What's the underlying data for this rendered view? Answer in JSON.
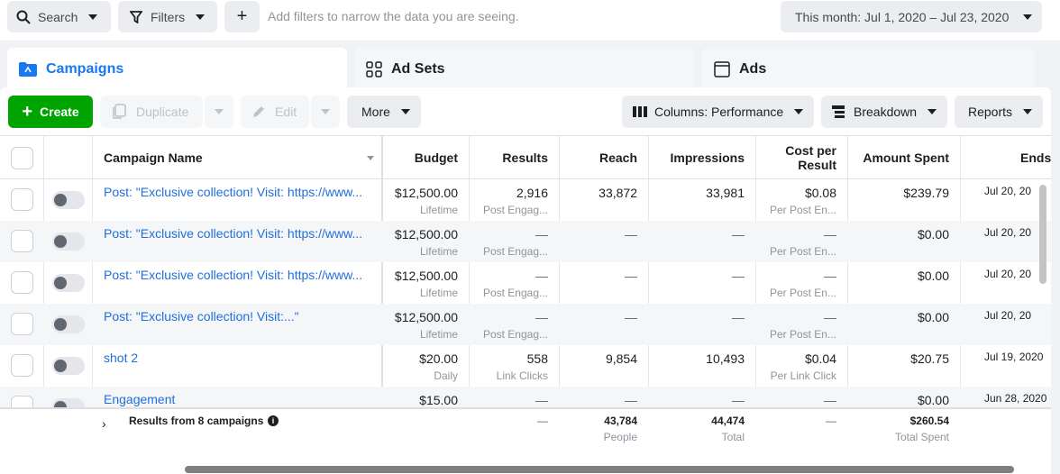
{
  "topbar": {
    "search_label": "Search",
    "filters_label": "Filters",
    "add_filters_text": "Add filters to narrow the data you are seeing.",
    "date_range": "This month: Jul 1, 2020 – Jul 23, 2020"
  },
  "tabs": [
    {
      "label": "Campaigns",
      "icon": "folder-icon"
    },
    {
      "label": "Ad Sets",
      "icon": "grid-icon"
    },
    {
      "label": "Ads",
      "icon": "window-icon"
    }
  ],
  "toolbar": {
    "create": "Create",
    "duplicate": "Duplicate",
    "edit": "Edit",
    "more": "More",
    "columns": "Columns: Performance",
    "breakdown": "Breakdown",
    "reports": "Reports"
  },
  "headers": {
    "name": "Campaign Name",
    "budget": "Budget",
    "results": "Results",
    "reach": "Reach",
    "impressions": "Impressions",
    "cost_line1": "Cost per",
    "cost_line2": "Result",
    "spent": "Amount Spent",
    "ends": "Ends"
  },
  "rows": [
    {
      "name": "Post: \"Exclusive collection! Visit: https://www...",
      "budget": "$12,500.00",
      "budget_type": "Lifetime",
      "results": "2,916",
      "results_type": "Post Engag...",
      "reach": "33,872",
      "impressions": "33,981",
      "cost": "$0.08",
      "cost_type": "Per Post En...",
      "spent": "$239.79",
      "ends": "Jul 20, 20"
    },
    {
      "name": "Post: \"Exclusive collection! Visit: https://www...",
      "budget": "$12,500.00",
      "budget_type": "Lifetime",
      "results": "—",
      "results_type": "Post Engag...",
      "reach": "—",
      "impressions": "—",
      "cost": "—",
      "cost_type": "Per Post En...",
      "spent": "$0.00",
      "ends": "Jul 20, 20"
    },
    {
      "name": "Post: \"Exclusive collection! Visit: https://www...",
      "budget": "$12,500.00",
      "budget_type": "Lifetime",
      "results": "—",
      "results_type": "Post Engag...",
      "reach": "—",
      "impressions": "—",
      "cost": "—",
      "cost_type": "Per Post En...",
      "spent": "$0.00",
      "ends": "Jul 20, 20"
    },
    {
      "name": "Post: \"Exclusive collection! Visit:...\"",
      "budget": "$12,500.00",
      "budget_type": "Lifetime",
      "results": "—",
      "results_type": "Post Engag...",
      "reach": "—",
      "impressions": "—",
      "cost": "—",
      "cost_type": "Per Post En...",
      "spent": "$0.00",
      "ends": "Jul 20, 20"
    },
    {
      "name": "shot 2",
      "budget": "$20.00",
      "budget_type": "Daily",
      "results": "558",
      "results_type": "Link Clicks",
      "reach": "9,854",
      "impressions": "10,493",
      "cost": "$0.04",
      "cost_type": "Per Link Click",
      "spent": "$20.75",
      "ends": "Jul 19, 2020"
    },
    {
      "name": "Engagement",
      "budget": "$15.00",
      "budget_type": "",
      "results": "—",
      "results_type": "",
      "reach": "—",
      "impressions": "—",
      "cost": "—",
      "cost_type": "",
      "spent": "$0.00",
      "ends": "Jun 28, 2020"
    }
  ],
  "footer": {
    "label": "Results from 8 campaigns",
    "results": "—",
    "reach": "43,784",
    "reach_unit": "People",
    "impressions": "44,474",
    "impressions_unit": "Total",
    "cost": "—",
    "spent": "$260.54",
    "spent_unit": "Total Spent"
  },
  "colors": {
    "accent": "#1877f2",
    "create": "#00a400",
    "link": "#216fdb"
  }
}
